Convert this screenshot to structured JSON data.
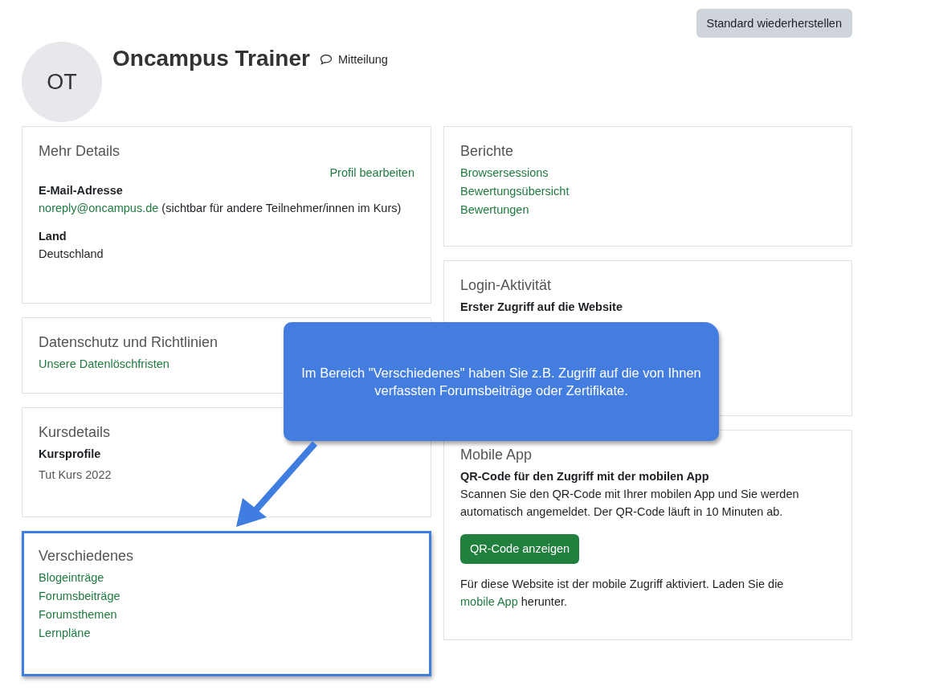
{
  "reset_button": "Standard wiederherstellen",
  "profile": {
    "initials": "OT",
    "name": "Oncampus Trainer",
    "message_link": "Mitteilung"
  },
  "left_column": [
    {
      "title": "Mehr Details",
      "highlighted": false,
      "blocks": [
        {
          "kind": "action_link",
          "text": "Profil bearbeiten"
        },
        {
          "kind": "field",
          "label": "E-Mail-Adresse",
          "link": "noreply@oncampus.de",
          "value": "(sichtbar für andere Teilnehmer/innen im Kurs)"
        },
        {
          "kind": "field",
          "label": "Land",
          "value": "Deutschland"
        }
      ]
    },
    {
      "title": "Datenschutz und Richtlinien",
      "highlighted": false,
      "blocks": [
        {
          "kind": "link",
          "text": "Unsere Datenlöschfristen"
        }
      ]
    },
    {
      "title": "Kursdetails",
      "highlighted": false,
      "blocks": [
        {
          "kind": "field",
          "label": "Kursprofile",
          "value": "Tut Kurs 2022"
        }
      ]
    },
    {
      "title": "Verschiedenes",
      "highlighted": true,
      "blocks": [
        {
          "kind": "link",
          "text": "Blogeinträge"
        },
        {
          "kind": "link",
          "text": "Forumsbeiträge"
        },
        {
          "kind": "link",
          "text": "Forumsthemen"
        },
        {
          "kind": "link",
          "text": "Lernpläne"
        }
      ]
    }
  ],
  "right_column": [
    {
      "title": "Berichte",
      "highlighted": false,
      "blocks": [
        {
          "kind": "link",
          "text": "Browsersessions"
        },
        {
          "kind": "link",
          "text": "Bewertungsübersicht"
        },
        {
          "kind": "link",
          "text": "Bewertungen"
        }
      ]
    },
    {
      "title": "Login-Aktivität",
      "highlighted": false,
      "blocks": [
        {
          "kind": "field",
          "label": "Erster Zugriff auf die Website"
        }
      ]
    },
    {
      "title": "Mobile App",
      "highlighted": false,
      "blocks": [
        {
          "kind": "field",
          "label": "QR-Code für den Zugriff mit der mobilen App",
          "value": "Scannen Sie den QR-Code mit Ihrer mobilen App und Sie werden automatisch angemeldet. Der QR-Code läuft in 10 Minuten ab."
        },
        {
          "kind": "button",
          "text": "QR-Code anzeigen"
        },
        {
          "kind": "note",
          "text": "Für diese Website ist der mobile Zugriff aktiviert. Laden Sie die",
          "link": "mobile App",
          "after": "herunter."
        }
      ]
    }
  ],
  "callout": {
    "text": "Im Bereich \"Verschiedenes\" haben Sie z.B. Zugriff auf die von Ihnen verfassten Forumsbeiträge oder Zertifikate."
  }
}
